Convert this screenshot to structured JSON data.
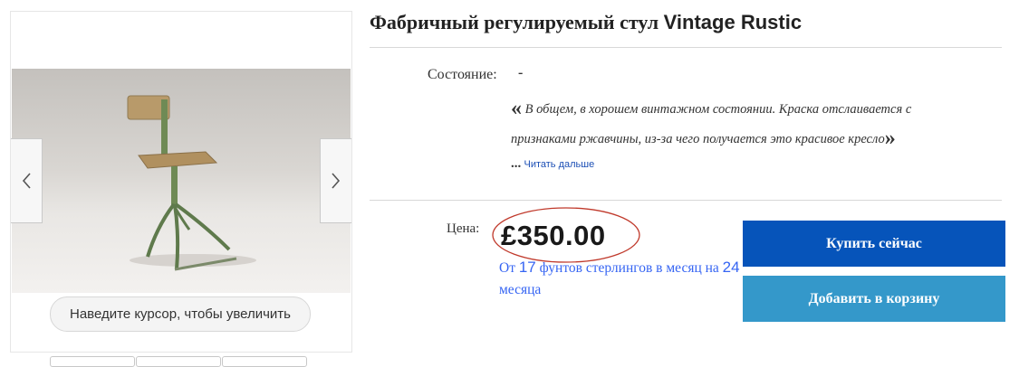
{
  "product": {
    "title_cyrillic": "Фабричный регулируемый стул ",
    "title_latin": "Vintage Rustic"
  },
  "gallery": {
    "zoom_hint": "Наведите курсор, чтобы увеличить",
    "prev_icon": "chevron-left-icon",
    "next_icon": "chevron-right-icon"
  },
  "condition": {
    "label": "Состояние:",
    "value": "-",
    "quote_open": "«",
    "quote_close": "»",
    "description": " В общем, в хорошем винтажном состоянии. Краска отслаивается с признаками ржавчины, из-за чего получается это красивое кресло",
    "ellipsis": "...",
    "read_more": "Читать дальше"
  },
  "price": {
    "label": "Цена:",
    "value": "£350.00",
    "installment_part1": "От ",
    "installment_amount": "17",
    "installment_part2": " фунтов стерлингов в месяц на ",
    "installment_months": "24",
    "installment_part3": " месяца",
    "highlight_color": "#c0392b"
  },
  "actions": {
    "buy_now": "Купить сейчас",
    "add_to_cart": "Добавить в корзину",
    "buy_color": "#0654ba",
    "cart_color": "#3498ca"
  }
}
